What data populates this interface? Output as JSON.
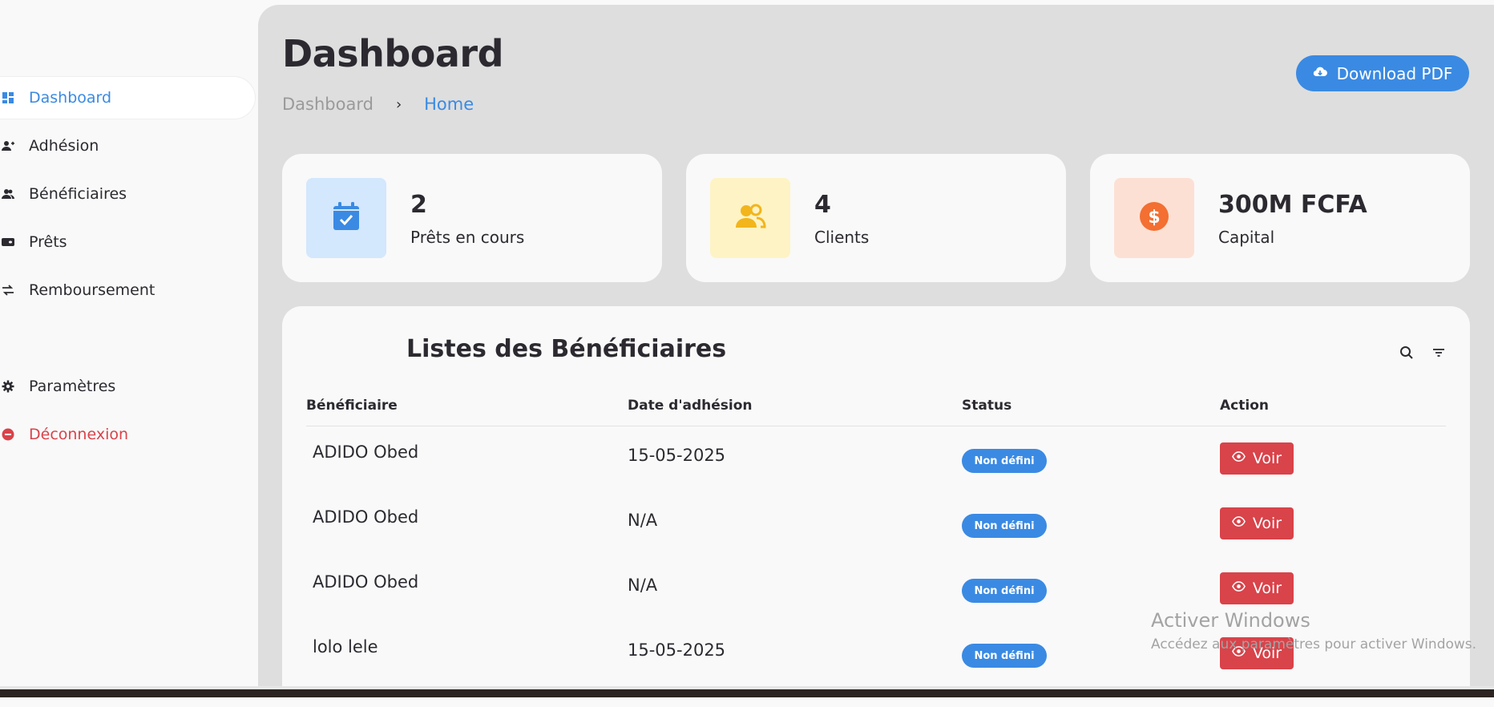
{
  "sidebar": {
    "items": [
      {
        "label": "Dashboard",
        "icon": "dashboard-icon"
      },
      {
        "label": "Adhésion",
        "icon": "user-plus-icon"
      },
      {
        "label": "Bénéficiaires",
        "icon": "users-icon"
      },
      {
        "label": "Prêts",
        "icon": "wallet-icon"
      },
      {
        "label": "Remboursement",
        "icon": "swap-icon"
      },
      {
        "label": "Paramètres",
        "icon": "gear-icon"
      },
      {
        "label": "Déconnexion",
        "icon": "logout-icon"
      }
    ]
  },
  "header": {
    "title": "Dashboard",
    "breadcrumb": [
      "Dashboard",
      "Home"
    ],
    "download_label": "Download PDF"
  },
  "stats": [
    {
      "value": "2",
      "label": "Prêts en cours",
      "icon": "calendar-check-icon",
      "bg": "#d3e7fd",
      "fg": "#3a8ae3"
    },
    {
      "value": "4",
      "label": "Clients",
      "icon": "users-icon",
      "bg": "#fef3c4",
      "fg": "#f2b51c"
    },
    {
      "value": "300M FCFA",
      "label": "Capital",
      "icon": "dollar-icon",
      "bg": "#fde0d4",
      "fg": "#f36f32"
    }
  ],
  "table": {
    "title": "Listes des Bénéficiaires",
    "headers": [
      "Bénéficiaire",
      "Date d'adhésion",
      "Status",
      "Action"
    ],
    "rows": [
      {
        "name": "ADIDO Obed",
        "date": "15-05-2025",
        "status": "Non défini",
        "action": "Voir"
      },
      {
        "name": "ADIDO Obed",
        "date": "N/A",
        "status": "Non défini",
        "action": "Voir"
      },
      {
        "name": "ADIDO Obed",
        "date": "N/A",
        "status": "Non défini",
        "action": "Voir"
      },
      {
        "name": "lolo lele",
        "date": "15-05-2025",
        "status": "Non défini",
        "action": "Voir"
      }
    ]
  },
  "watermark": {
    "title": "Activer Windows",
    "subtitle": "Accédez aux paramètres pour activer Windows."
  },
  "colors": {
    "accent": "#3a8ae3",
    "danger": "#d9434a",
    "main_bg": "#dedede",
    "card_bg": "#f9f9f9"
  }
}
